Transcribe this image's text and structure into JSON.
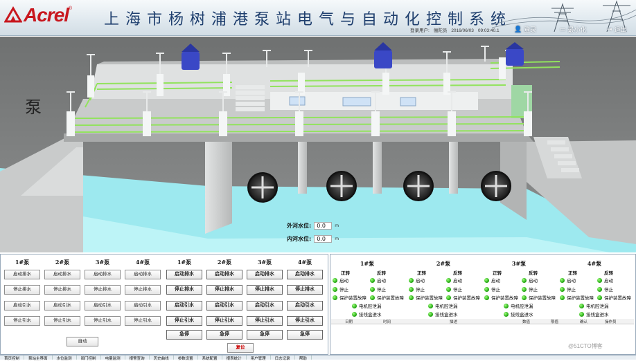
{
  "header": {
    "brand": "Acrel",
    "brand_mark": "®",
    "title": "上海市杨树浦港泵站电气与自动化控制系统",
    "user_label": "登录用户:",
    "user_name": "俪陀员",
    "date": "2016/06/03",
    "time": "09:03:40.1",
    "login_label": "登录",
    "minimize_label": "最小化",
    "exit_label": "退出"
  },
  "scene": {
    "pump_label": "泵",
    "outer_water_label": "外河水位:",
    "outer_water_value": "0.0",
    "inner_water_label": "内河水位:",
    "inner_water_value": "0.0",
    "water_unit": "m"
  },
  "control": {
    "pumps": [
      "1#泵",
      "2#泵",
      "3#泵",
      "4#泵"
    ],
    "left_buttons": [
      "启动排水",
      "停止排水",
      "启动引水",
      "停止引水"
    ],
    "right_buttons": [
      "启动排水",
      "停止排水",
      "启动引水",
      "停止引水",
      "急停"
    ],
    "auto_label": "自动",
    "reset_label": "复位"
  },
  "status": {
    "pumps": [
      "1#泵",
      "2#泵",
      "3#泵",
      "4#泵"
    ],
    "forward": "正转",
    "reverse": "反转",
    "start": "启动",
    "stop": "停止",
    "fault": "保护装置故障",
    "motor_leak": "电机腔泄漏",
    "junction_water": "接线盒进水"
  },
  "log": {
    "columns": [
      "日期",
      "时间",
      "描述",
      "数值",
      "限值",
      "确认",
      "操作员"
    ]
  },
  "bottom_tabs": [
    "首页控制",
    "泵站主界面",
    "水位监测",
    "阀门控制",
    "电量监测",
    "报警查询",
    "历史曲线",
    "参数设置",
    "系统配置",
    "报表统计",
    "用户管理",
    "日志记录",
    "帮助"
  ],
  "watermark": "@51CTO博客"
}
